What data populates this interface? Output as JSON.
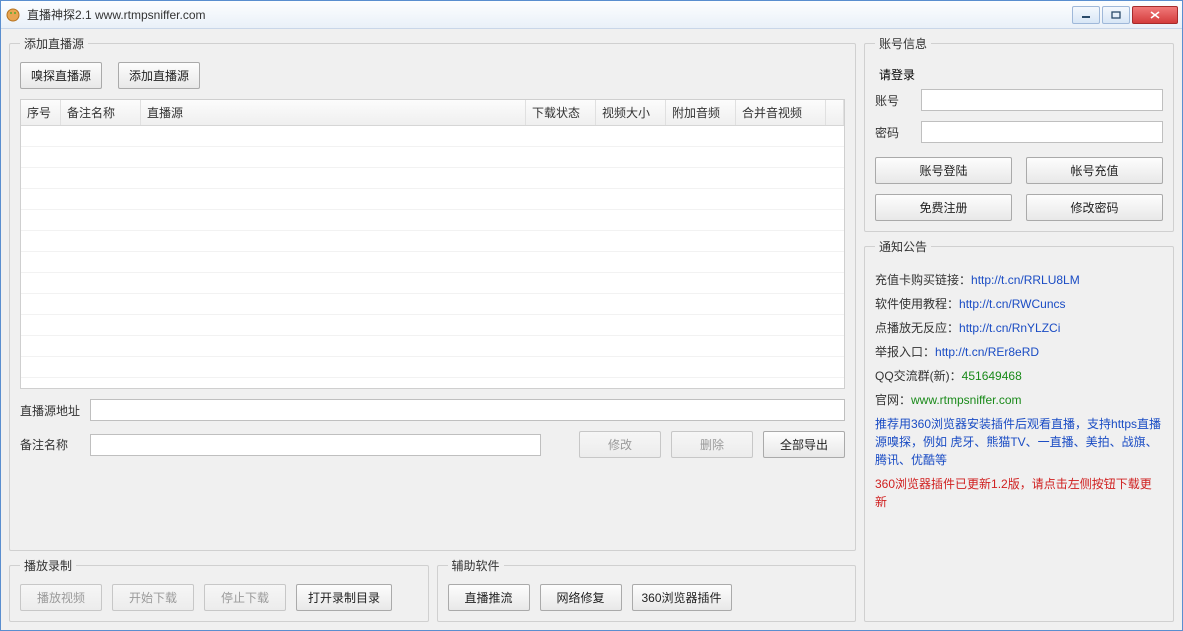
{
  "window": {
    "title": "直播神探2.1 www.rtmpsniffer.com"
  },
  "addSource": {
    "legend": "添加直播源",
    "sniffBtn": "嗅探直播源",
    "addBtn": "添加直播源",
    "columns": [
      "序号",
      "备注名称",
      "直播源",
      "下载状态",
      "视频大小",
      "附加音频",
      "合并音视频"
    ],
    "sourceAddrLabel": "直播源地址",
    "remarkLabel": "备注名称",
    "modifyBtn": "修改",
    "deleteBtn": "删除",
    "exportAllBtn": "全部导出"
  },
  "playback": {
    "legend": "播放录制",
    "playBtn": "播放视频",
    "startBtn": "开始下载",
    "stopBtn": "停止下载",
    "openDirBtn": "打开录制目录"
  },
  "aux": {
    "legend": "辅助软件",
    "pushBtn": "直播推流",
    "netfixBtn": "网络修复",
    "pluginBtn": "360浏览器插件"
  },
  "account": {
    "legend": "账号信息",
    "loginPrompt": "请登录",
    "userLabel": "账号",
    "passLabel": "密码",
    "loginBtn": "账号登陆",
    "rechargeBtn": "帐号充值",
    "registerBtn": "免费注册",
    "changePwdBtn": "修改密码"
  },
  "notice": {
    "legend": "通知公告",
    "buyLabel": "充值卡购买链接：",
    "buyLink": "http://t.cn/RRLU8LM",
    "tutorialLabel": "软件使用教程：",
    "tutorialLink": "http://t.cn/RWCuncs",
    "noRespLabel": "点播放无反应：",
    "noRespLink": "http://t.cn/RnYLZCi",
    "reportLabel": "举报入口：",
    "reportLink": "http://t.cn/REr8eRD",
    "qqLabel": "QQ交流群(新)：",
    "qqGroup": "451649468",
    "siteLabel": "官网：",
    "siteLink": "www.rtmpsniffer.com",
    "recommend": "推荐用360浏览器安装插件后观看直播，支持https直播源嗅探，例如 虎牙、熊猫TV、一直播、美拍、战旗、腾讯、优酷等",
    "update": "360浏览器插件已更新1.2版，请点击左侧按钮下载更新"
  }
}
